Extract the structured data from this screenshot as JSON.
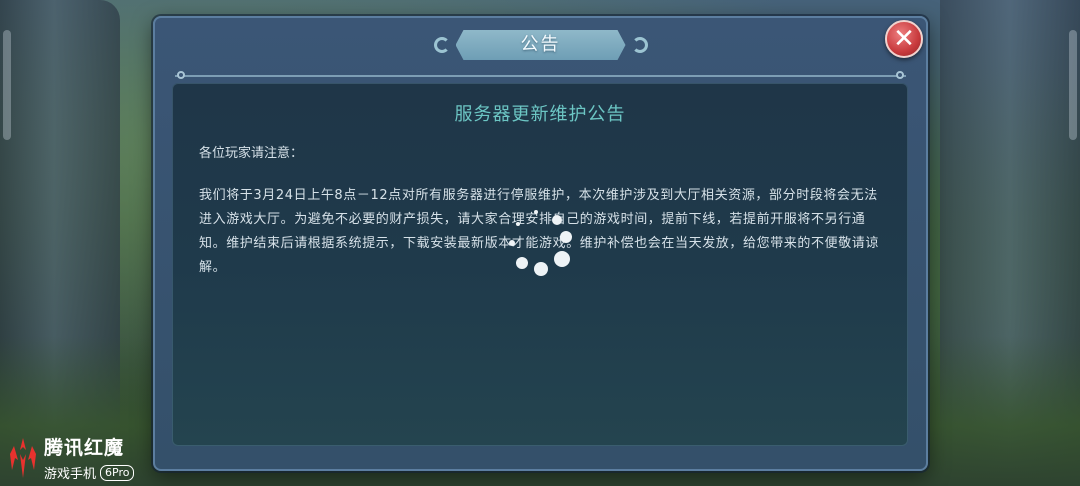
{
  "dialog": {
    "title": "公告",
    "close_icon": "✕"
  },
  "notice": {
    "heading": "服务器更新维护公告",
    "greeting": "各位玩家请注意：",
    "body": "我们将于3月24日上午8点－12点对所有服务器进行停服维护，本次维护涉及到大厅相关资源，部分时段将会无法进入游戏大厅。为避免不必要的财产损失，请大家合理安排自己的游戏时间，提前下线，若提前开服将不另行通知。维护结束后请根据系统提示，下载安装最新版本才能游戏。维护补偿也会在当天发放，给您带来的不便敬请谅解。"
  },
  "loading": {
    "icon": "spinner-icon"
  },
  "watermark": {
    "brand": "腾讯红魔",
    "subtitle": "游戏手机",
    "model": "6Pro"
  },
  "colors": {
    "panel": "#3b5676",
    "content_bg": "#1f3648",
    "heading": "#6cc6c4",
    "close_button": "#c83a3d"
  }
}
